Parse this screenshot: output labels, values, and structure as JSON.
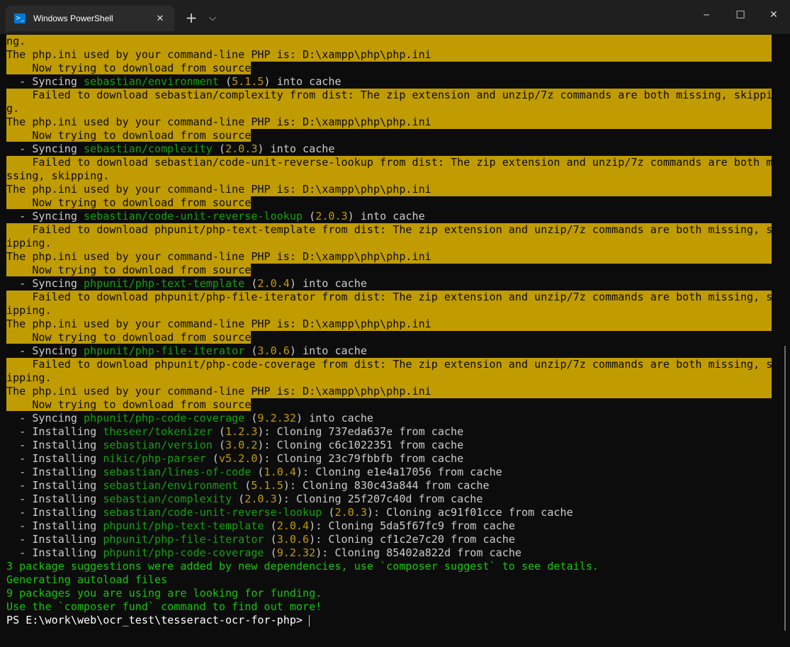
{
  "window": {
    "tab_title": "Windows PowerShell",
    "tab_icon": "powershell-icon",
    "tab_close": "✕",
    "new_tab": "+",
    "dropdown": "⌵",
    "minimize": "─",
    "maximize": "☐",
    "close": "✕"
  },
  "terminal": {
    "lines": {
      "l0": "ng.",
      "l1": "The php.ini used by your command-line PHP is: D:\\xampp\\php\\php.ini",
      "l2": "    Now trying to download from source",
      "l3a": "  - Syncing ",
      "l3b": "sebastian/environment",
      "l3c": " (",
      "l3d": "5.1.5",
      "l3e": ") into cache",
      "l4": "    Failed to download sebastian/complexity from dist: The zip extension and unzip/7z commands are both missing, skippin",
      "l5": "g.",
      "l6": "The php.ini used by your command-line PHP is: D:\\xampp\\php\\php.ini",
      "l7": "    Now trying to download from source",
      "l8a": "  - Syncing ",
      "l8b": "sebastian/complexity",
      "l8c": " (",
      "l8d": "2.0.3",
      "l8e": ") into cache",
      "l9": "    Failed to download sebastian/code-unit-reverse-lookup from dist: The zip extension and unzip/7z commands are both mi",
      "l10": "ssing, skipping.",
      "l11": "The php.ini used by your command-line PHP is: D:\\xampp\\php\\php.ini",
      "l12": "    Now trying to download from source",
      "l13a": "  - Syncing ",
      "l13b": "sebastian/code-unit-reverse-lookup",
      "l13c": " (",
      "l13d": "2.0.3",
      "l13e": ") into cache",
      "l14": "    Failed to download phpunit/php-text-template from dist: The zip extension and unzip/7z commands are both missing, sk",
      "l15": "ipping.",
      "l16": "The php.ini used by your command-line PHP is: D:\\xampp\\php\\php.ini",
      "l17": "    Now trying to download from source",
      "l18a": "  - Syncing ",
      "l18b": "phpunit/php-text-template",
      "l18c": " (",
      "l18d": "2.0.4",
      "l18e": ") into cache",
      "l19": "    Failed to download phpunit/php-file-iterator from dist: The zip extension and unzip/7z commands are both missing, sk",
      "l20": "ipping.",
      "l21": "The php.ini used by your command-line PHP is: D:\\xampp\\php\\php.ini",
      "l22": "    Now trying to download from source",
      "l23a": "  - Syncing ",
      "l23b": "phpunit/php-file-iterator",
      "l23c": " (",
      "l23d": "3.0.6",
      "l23e": ") into cache",
      "l24": "    Failed to download phpunit/php-code-coverage from dist: The zip extension and unzip/7z commands are both missing, sk",
      "l25": "ipping.",
      "l26": "The php.ini used by your command-line PHP is: D:\\xampp\\php\\php.ini",
      "l27": "    Now trying to download from source",
      "l28a": "  - Syncing ",
      "l28b": "phpunit/php-code-coverage",
      "l28c": " (",
      "l28d": "9.2.32",
      "l28e": ") into cache",
      "l29a": "  - Installing ",
      "l29b": "theseer/tokenizer",
      "l29c": " (",
      "l29d": "1.2.3",
      "l29e": "): Cloning 737eda637e from cache",
      "l30a": "  - Installing ",
      "l30b": "sebastian/version",
      "l30c": " (",
      "l30d": "3.0.2",
      "l30e": "): Cloning c6c1022351 from cache",
      "l31a": "  - Installing ",
      "l31b": "nikic/php-parser",
      "l31c": " (",
      "l31d": "v5.2.0",
      "l31e": "): Cloning 23c79fbbfb from cache",
      "l32a": "  - Installing ",
      "l32b": "sebastian/lines-of-code",
      "l32c": " (",
      "l32d": "1.0.4",
      "l32e": "): Cloning e1e4a17056 from cache",
      "l33a": "  - Installing ",
      "l33b": "sebastian/environment",
      "l33c": " (",
      "l33d": "5.1.5",
      "l33e": "): Cloning 830c43a844 from cache",
      "l34a": "  - Installing ",
      "l34b": "sebastian/complexity",
      "l34c": " (",
      "l34d": "2.0.3",
      "l34e": "): Cloning 25f207c40d from cache",
      "l35a": "  - Installing ",
      "l35b": "sebastian/code-unit-reverse-lookup",
      "l35c": " (",
      "l35d": "2.0.3",
      "l35e": "): Cloning ac91f01cce from cache",
      "l36a": "  - Installing ",
      "l36b": "phpunit/php-text-template",
      "l36c": " (",
      "l36d": "2.0.4",
      "l36e": "): Cloning 5da5f67fc9 from cache",
      "l37a": "  - Installing ",
      "l37b": "phpunit/php-file-iterator",
      "l37c": " (",
      "l37d": "3.0.6",
      "l37e": "): Cloning cf1c2e7c20 from cache",
      "l38a": "  - Installing ",
      "l38b": "phpunit/php-code-coverage",
      "l38c": " (",
      "l38d": "9.2.32",
      "l38e": "): Cloning 85402a822d from cache",
      "l39": "3 package suggestions were added by new dependencies, use `composer suggest` to see details.",
      "l40": "Generating autoload files",
      "l41": "9 packages you are using are looking for funding.",
      "l42": "Use the `composer fund` command to find out more!",
      "l43": "PS E:\\work\\web\\ocr_test\\tesseract-ocr-for-php> "
    }
  },
  "colors": {
    "background": "#0c0c0c",
    "warning_bg": "#c19c00",
    "package": "#13a10e",
    "version": "#c19c00",
    "success": "#16c60c",
    "text": "#cccccc"
  }
}
